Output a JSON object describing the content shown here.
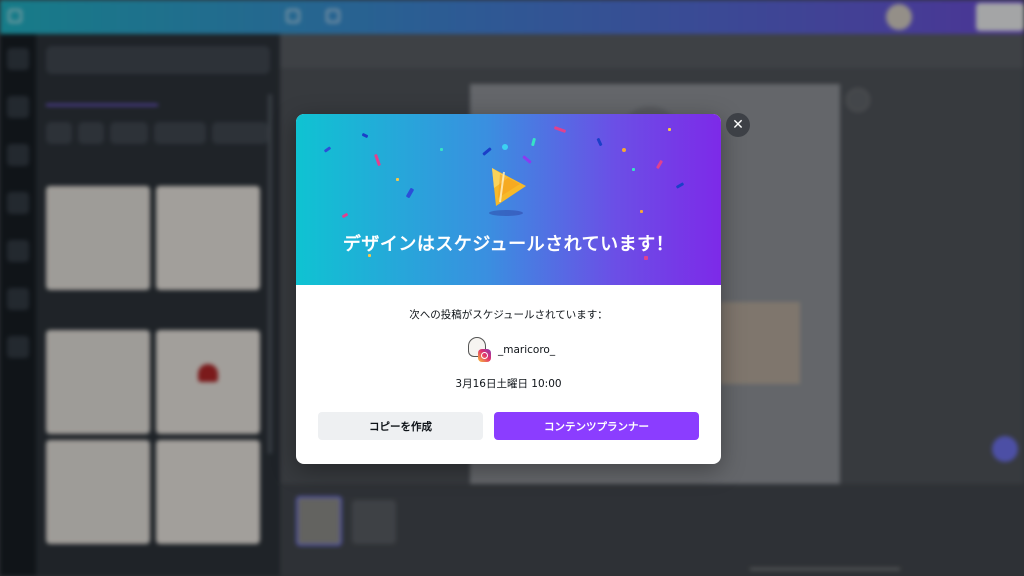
{
  "modal": {
    "title": "デザインはスケジュールされています！",
    "subtitle": "次への投稿がスケジュールされています：",
    "account_handle": "_maricoro_",
    "scheduled_time": "3月16日土曜日 10:00",
    "copy_button": "コピーを作成",
    "planner_button": "コンテンツプランナー",
    "close_icon": "close-icon",
    "hero_icon": "party-popper-icon",
    "account_platform_icon": "instagram-icon",
    "colors": {
      "gradient_start": "#0fc3d2",
      "gradient_end": "#7d2ae8",
      "planner_button": "#8b3dff",
      "copy_button": "#eef0f2"
    }
  }
}
